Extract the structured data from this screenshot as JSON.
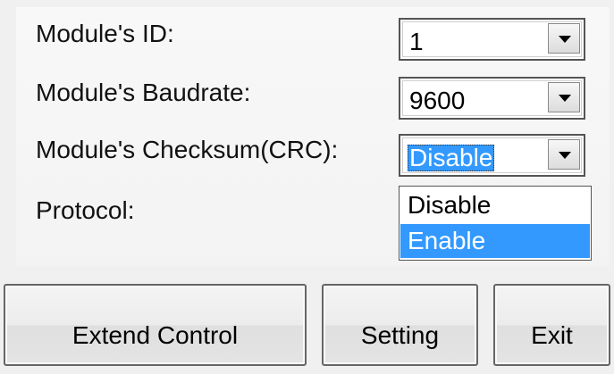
{
  "form": {
    "module_id": {
      "label": "Module's  ID:",
      "value": "1"
    },
    "module_baudrate": {
      "label": "Module's Baudrate:",
      "value": "9600"
    },
    "module_checksum": {
      "label": "Module's Checksum(CRC):",
      "value": "Disable",
      "options": [
        "Disable",
        "Enable"
      ],
      "highlighted_option": "Enable"
    },
    "protocol": {
      "label": "Protocol:"
    }
  },
  "buttons": {
    "extend_control": "Extend Control",
    "setting": "Setting",
    "exit": "Exit"
  },
  "colors": {
    "selection": "#3399ff",
    "background": "#f0f0f0"
  },
  "icons": {
    "combo_arrow": "chevron-down-icon"
  }
}
